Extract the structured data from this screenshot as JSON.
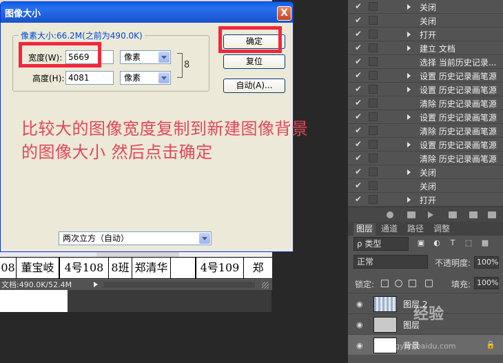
{
  "dialog": {
    "title": "图像大小",
    "close_symbol": "X",
    "pixel_size_label": "像素大小:66.2M(之前为490.0K)",
    "width_label": "宽度(W):",
    "width_value": "5669",
    "width_unit": "像素",
    "height_label": "高度(H):",
    "height_value": "4081",
    "height_unit": "像素",
    "link_symbol": "8",
    "ok_button": "确定",
    "reset_button": "复位",
    "auto_button": "自动(A)...",
    "resample_method": "两次立方（自动）"
  },
  "annotation": {
    "text": "比较大的图像宽度复制到新建图像背景\n的图像大小 然后点击确定",
    "color": "#e0485a",
    "box_color": "#f0283c"
  },
  "document": {
    "row_cells": [
      "08",
      "董宝岐",
      "4号108",
      "8班",
      "郑清华",
      "4号109",
      "郑"
    ],
    "status_text": "文档:490.0K/52.4M"
  },
  "history": {
    "items": [
      {
        "label": "关闭",
        "expandable": true
      },
      {
        "label": "关闭",
        "expandable": false
      },
      {
        "label": "打开",
        "expandable": true
      },
      {
        "label": "建立 文档",
        "expandable": true
      },
      {
        "label": "选择 当前历史记录...",
        "expandable": false
      },
      {
        "label": "设置 历史记录画笔源",
        "expandable": true
      },
      {
        "label": "设置 历史记录画笔源",
        "expandable": true
      },
      {
        "label": "清除 历史记录画笔源",
        "expandable": false
      },
      {
        "label": "设置 历史记录画笔源",
        "expandable": true
      },
      {
        "label": "清除 历史记录画笔源",
        "expandable": false
      },
      {
        "label": "设置 历史记录画笔源",
        "expandable": true
      },
      {
        "label": "清除 历史记录画笔源",
        "expandable": false
      },
      {
        "label": "关闭",
        "expandable": true
      },
      {
        "label": "关闭",
        "expandable": false
      },
      {
        "label": "打开",
        "expandable": true
      }
    ],
    "check_symbol": "✔"
  },
  "layers_panel": {
    "tabs": [
      "图层",
      "通道",
      "路径",
      "调整"
    ],
    "filter_label": "ρ 类型",
    "blend_mode": "正常",
    "opacity_label": "不透明度:",
    "opacity_value": "100%",
    "lock_label": "锁定:",
    "fill_label": "填充:",
    "fill_value": "100%",
    "layers": [
      {
        "name": "图层 2"
      },
      {
        "name": "图层"
      },
      {
        "name": "背景"
      }
    ]
  },
  "watermark": {
    "text": "经验",
    "url": "jingyan.baidu.com"
  }
}
